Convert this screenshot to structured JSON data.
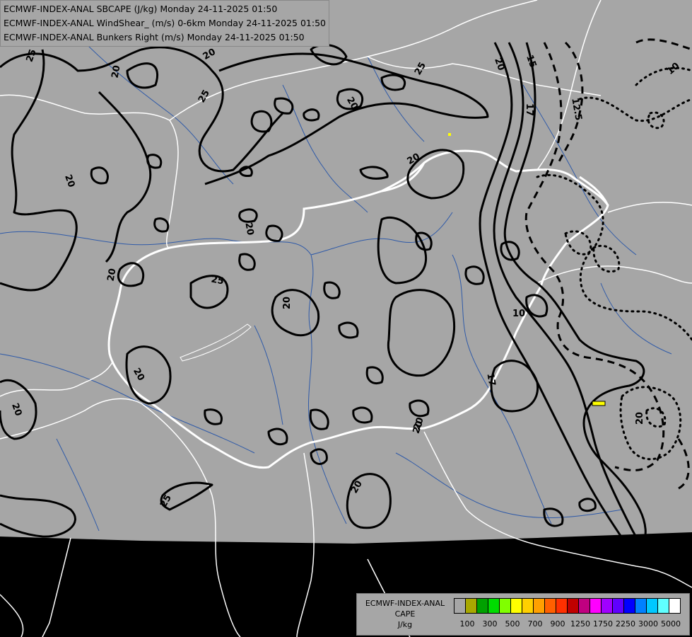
{
  "titles": [
    "ECMWF-INDEX-ANAL SBCAPE (J/kg) Monday 24-11-2025 01:50",
    "ECMWF-INDEX-ANAL WindShear_ (m/s) 0-6km Monday 24-11-2025 01:50",
    "ECMWF-INDEX-ANAL Bunkers Right (m/s) Monday 24-11-2025 01:50"
  ],
  "legend": {
    "line1": "ECMWF-INDEX-ANAL",
    "line2": "CAPE",
    "line3": "J/kg",
    "colors": [
      "#a6a6a6",
      "#a8a800",
      "#00a000",
      "#00dc00",
      "#80ff00",
      "#ffff00",
      "#ffd000",
      "#ffa000",
      "#ff6000",
      "#ff3000",
      "#c00000",
      "#c00080",
      "#ff00ff",
      "#a000ff",
      "#6000ff",
      "#0000ff",
      "#0080ff",
      "#00c8ff",
      "#60ffff",
      "#ffffff"
    ],
    "ticks": [
      "100",
      "300",
      "500",
      "700",
      "900",
      "1250",
      "1750",
      "2250",
      "3000",
      "5000"
    ]
  },
  "contour_labels": [
    "25",
    "20",
    "20",
    "25",
    "20",
    "25",
    "20",
    "15",
    "17",
    "12.5",
    "10",
    "20",
    "20",
    "20",
    "25",
    "20",
    "20",
    "20",
    "20",
    "17",
    "20",
    "20",
    "10",
    "20",
    "20",
    "25"
  ],
  "colors": {
    "background": "#a6a6a6",
    "outside": "#000000",
    "border": "#ffffff",
    "river": "#2f5aa8"
  }
}
